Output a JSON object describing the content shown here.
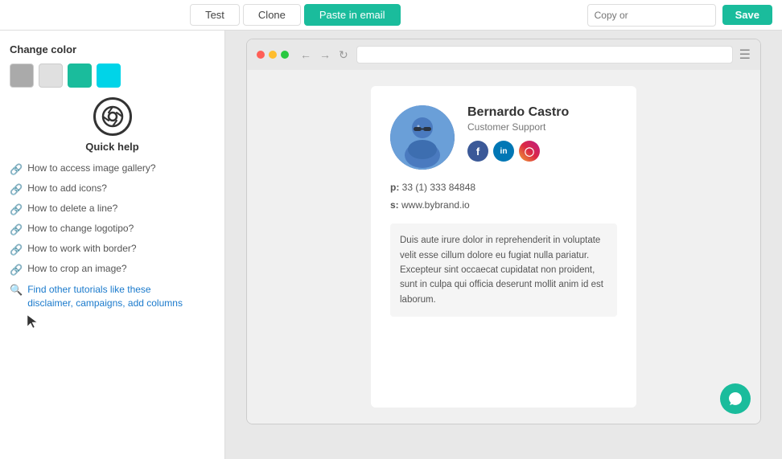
{
  "toolbar": {
    "tabs": [
      {
        "id": "test",
        "label": "Test",
        "active": false
      },
      {
        "id": "clone",
        "label": "Clone",
        "active": false
      },
      {
        "id": "paste-in-email",
        "label": "Paste in email",
        "active": true
      }
    ],
    "copy_placeholder": "Copy or",
    "save_label": "Save"
  },
  "sidebar": {
    "color_section": {
      "title": "Change color",
      "swatches": [
        {
          "id": "gray",
          "color": "#aaaaaa"
        },
        {
          "id": "light-gray",
          "color": "#e0e0e0"
        },
        {
          "id": "teal",
          "color": "#1abc9c"
        },
        {
          "id": "cyan",
          "color": "#00d4e8"
        }
      ]
    },
    "quick_help": {
      "title": "Quick help",
      "links": [
        {
          "id": "gallery",
          "text": "How to access image gallery?"
        },
        {
          "id": "icons",
          "text": "How to add icons?"
        },
        {
          "id": "delete-line",
          "text": "How to delete a line?"
        },
        {
          "id": "logotipo",
          "text": "How to change logotipo?"
        },
        {
          "id": "border",
          "text": "How to work with border?"
        },
        {
          "id": "crop",
          "text": "How to crop an image?"
        }
      ],
      "find_tutorials": {
        "label": "Find other tutorials like these",
        "sub_label": "disclaimer, campaigns, add columns"
      }
    }
  },
  "preview": {
    "signature": {
      "name": "Bernardo Castro",
      "title": "Customer Support",
      "phone": "33 (1) 333 84848",
      "website": "www.bybrand.io",
      "phone_label": "p:",
      "website_label": "s:",
      "bio": "Duis aute irure dolor in reprehenderit in voluptate velit esse cillum dolore eu fugiat nulla pariatur. Excepteur sint occaecat cupidatat non proident, sunt in culpa qui officia deserunt mollit anim id est laborum.",
      "socials": [
        {
          "id": "facebook",
          "letter": "f",
          "class": "social-fb"
        },
        {
          "id": "linkedin",
          "letter": "in",
          "class": "social-li"
        },
        {
          "id": "instagram",
          "letter": "✦",
          "class": "social-ig"
        }
      ]
    }
  }
}
